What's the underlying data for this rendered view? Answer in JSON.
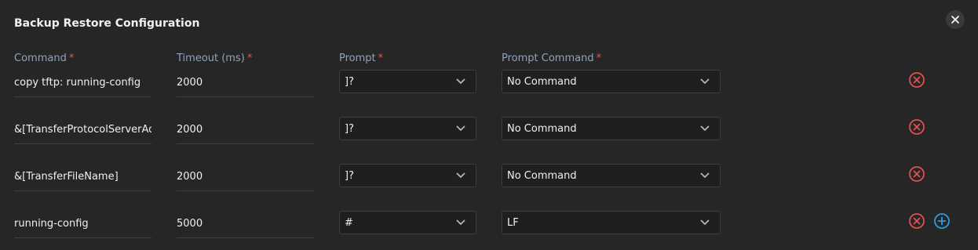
{
  "dialog": {
    "title": "Backup Restore Configuration",
    "close_icon": "close-icon"
  },
  "columns": {
    "command": "Command",
    "timeout": "Timeout (ms)",
    "prompt": "Prompt",
    "prompt_command": "Prompt Command",
    "required_marker": "*"
  },
  "rows": [
    {
      "command": "copy tftp: running-config",
      "timeout": "2000",
      "prompt": "]?",
      "prompt_command": "No Command"
    },
    {
      "command": "&[TransferProtocolServerAddress]",
      "timeout": "2000",
      "prompt": "]?",
      "prompt_command": "No Command"
    },
    {
      "command": "&[TransferFileName]",
      "timeout": "2000",
      "prompt": "]?",
      "prompt_command": "No Command"
    },
    {
      "command": "running-config",
      "timeout": "5000",
      "prompt": "#",
      "prompt_command": "LF"
    }
  ],
  "icons": {
    "remove": "remove-circle-icon",
    "add": "add-circle-icon",
    "chevron": "chevron-down-icon"
  },
  "colors": {
    "remove": "#e05252",
    "add": "#2d9cdb",
    "header_label": "#8fa3bf",
    "required": "#e05252"
  }
}
